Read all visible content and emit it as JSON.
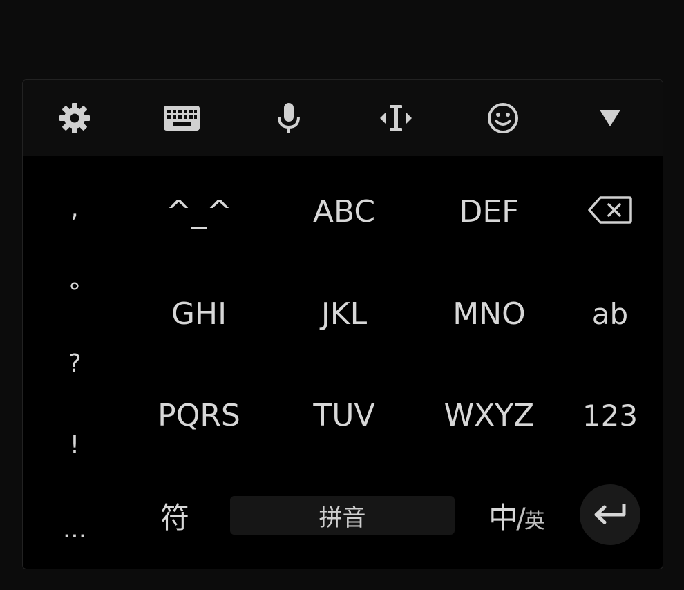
{
  "toolbar": {
    "icons": [
      "gear-icon",
      "keyboard-icon",
      "microphone-icon",
      "cursor-move-icon",
      "emoji-icon",
      "hide-keyboard-icon"
    ]
  },
  "punctuation": [
    ",",
    "°",
    "?",
    "!",
    "..."
  ],
  "keys": {
    "row1": [
      "^_^",
      "ABC",
      "DEF"
    ],
    "row2": [
      "GHI",
      "JKL",
      "MNO"
    ],
    "row3": [
      "PQRS",
      "TUV",
      "WXYZ"
    ]
  },
  "side_keys": {
    "ab": "ab",
    "num": "123"
  },
  "bottom": {
    "symbols": "符",
    "pinyin": "拼音",
    "lang_main": "中",
    "lang_slash": "/",
    "lang_sub": "英"
  },
  "colors": {
    "background": "#000000",
    "key_text": "#d7d7d7",
    "toolbar_bg": "#0d0d0d"
  }
}
